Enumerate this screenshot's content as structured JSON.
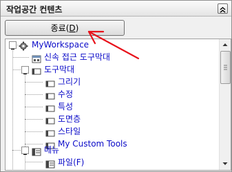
{
  "panel": {
    "title": "작업공간 컨텐츠",
    "collapse_icon": "double-chevron-up-icon"
  },
  "close_button": {
    "label_before": "종료(",
    "label_accel": "D",
    "label_after": ")"
  },
  "tree": {
    "root": "MyWorkspace",
    "quick_access": "신속 접근 도구막대",
    "toolbars": "도구막대",
    "toolbar_items": [
      "그리기",
      "수정",
      "특성",
      "도면층",
      "스타일",
      "My Custom Tools"
    ],
    "menus": "메뉴",
    "menu_items": [
      "파일(F)"
    ]
  },
  "icons": {
    "root": "gear-icon",
    "quick_access": "quick-access-toolbar-icon",
    "toolbar": "toolbar-icon",
    "menu": "menu-icon",
    "menu_item": "menu-item-icon",
    "expander": "collapse-minus-icon"
  },
  "annotation": {
    "arrow_color": "#e8121b"
  }
}
